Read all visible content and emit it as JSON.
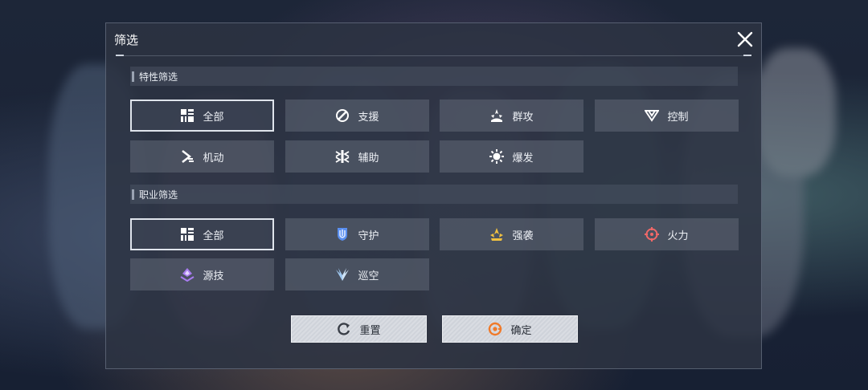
{
  "dialog": {
    "title": "筛选"
  },
  "trait_section": {
    "title": "特性筛选",
    "options": [
      {
        "label": "全部",
        "icon": "grid-icon",
        "selected": true
      },
      {
        "label": "支援",
        "icon": "support-icon",
        "selected": false
      },
      {
        "label": "群攻",
        "icon": "aoe-icon",
        "selected": false
      },
      {
        "label": "控制",
        "icon": "control-icon",
        "selected": false
      },
      {
        "label": "机动",
        "icon": "mobility-icon",
        "selected": false
      },
      {
        "label": "辅助",
        "icon": "assist-icon",
        "selected": false
      },
      {
        "label": "爆发",
        "icon": "burst-icon",
        "selected": false
      }
    ]
  },
  "class_section": {
    "title": "职业筛选",
    "options": [
      {
        "label": "全部",
        "icon": "grid-icon",
        "selected": true
      },
      {
        "label": "守护",
        "icon": "guard-shield-icon",
        "selected": false
      },
      {
        "label": "强袭",
        "icon": "assault-crown-icon",
        "selected": false
      },
      {
        "label": "火力",
        "icon": "firepower-crosshair-icon",
        "selected": false
      },
      {
        "label": "源技",
        "icon": "source-tech-icon",
        "selected": false
      },
      {
        "label": "巡空",
        "icon": "sky-patrol-wings-icon",
        "selected": false
      }
    ]
  },
  "actions": {
    "reset_label": "重置",
    "confirm_label": "确定"
  },
  "colors": {
    "guard": "#5a8ff0",
    "assault": "#f0c040",
    "firepower": "#f06868",
    "source_tech": "#a87cf0",
    "sky_patrol": "#9fc8f0",
    "confirm_icon": "#f07a2a"
  }
}
